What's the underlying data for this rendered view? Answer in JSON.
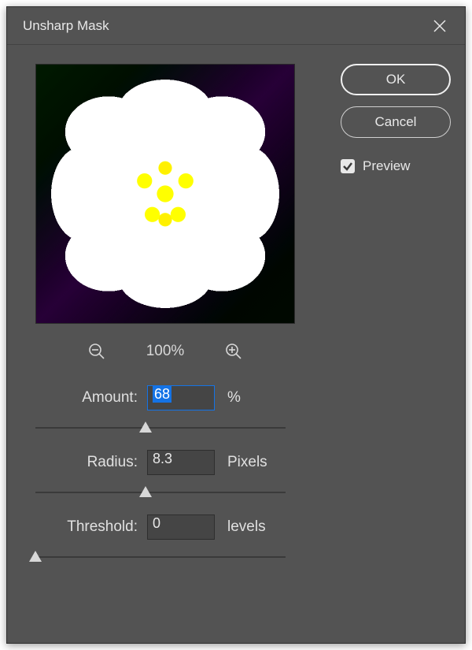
{
  "dialog": {
    "title": "Unsharp Mask"
  },
  "buttons": {
    "ok": "OK",
    "cancel": "Cancel"
  },
  "preview": {
    "checkbox_label": "Preview",
    "checked": true
  },
  "zoom": {
    "level": "100%"
  },
  "params": {
    "amount": {
      "label": "Amount:",
      "value": "68",
      "unit": "%",
      "slider_percent": 44
    },
    "radius": {
      "label": "Radius:",
      "value": "8.3",
      "unit": "Pixels",
      "slider_percent": 44
    },
    "threshold": {
      "label": "Threshold:",
      "value": "0",
      "unit": "levels",
      "slider_percent": 0
    }
  }
}
